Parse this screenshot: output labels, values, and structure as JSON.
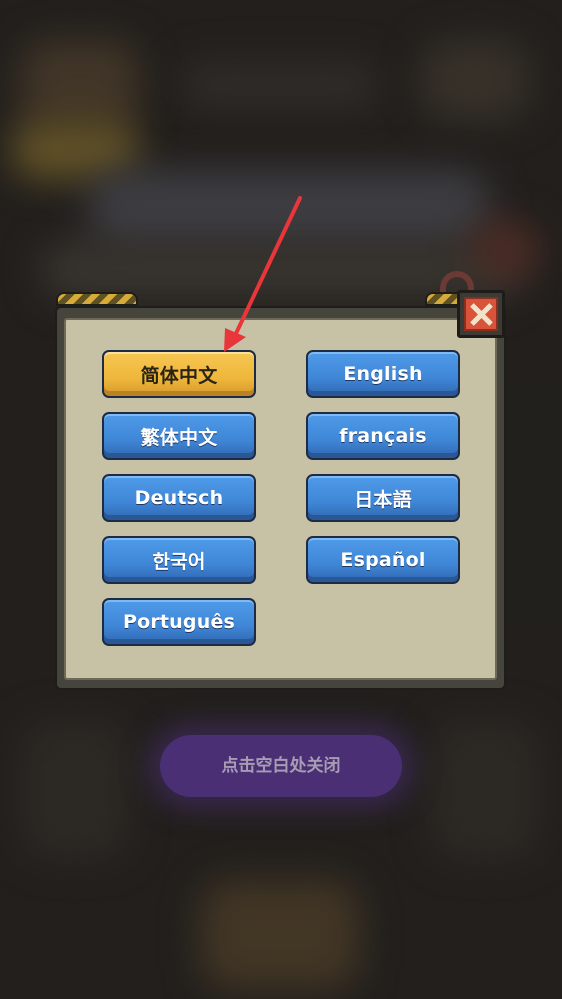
{
  "dialog": {
    "languages": [
      {
        "label": "简体中文",
        "selected": true
      },
      {
        "label": "English",
        "selected": false
      },
      {
        "label": "繁体中文",
        "selected": false
      },
      {
        "label": "français",
        "selected": false
      },
      {
        "label": "Deutsch",
        "selected": false
      },
      {
        "label": "日本語",
        "selected": false
      },
      {
        "label": "한국어",
        "selected": false
      },
      {
        "label": "Español",
        "selected": false
      },
      {
        "label": "Português",
        "selected": false
      }
    ]
  },
  "hint": {
    "close_text": "点击空白处关闭"
  },
  "colors": {
    "selected_button": "#efb73b",
    "default_button": "#3f86d6",
    "panel_fill": "#c7c2a6",
    "annotation_arrow": "#e8363a"
  },
  "icons": {
    "close": "close-x-icon"
  }
}
